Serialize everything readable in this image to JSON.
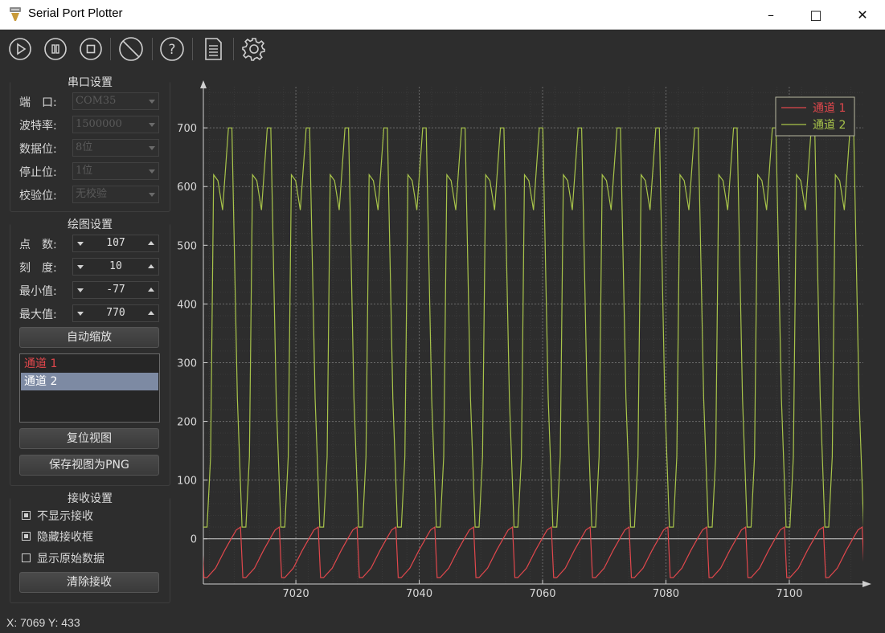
{
  "window": {
    "title": "Serial Port Plotter",
    "minimize": "–",
    "maximize": "□",
    "close": "✕"
  },
  "toolbar": [
    "play-icon",
    "pause-icon",
    "stop-icon",
    "clear-icon",
    "help-icon",
    "document-icon",
    "gear-icon"
  ],
  "serial": {
    "title": "串口设置",
    "port_label": "端　口:",
    "port_value": "COM35",
    "baud_label": "波特率:",
    "baud_value": "1500000",
    "databits_label": "数据位:",
    "databits_value": "8位",
    "stopbits_label": "停止位:",
    "stopbits_value": "1位",
    "parity_label": "校验位:",
    "parity_value": "无校验"
  },
  "plot_settings": {
    "title": "绘图设置",
    "points_label": "点　数:",
    "points_value": "107",
    "scale_label": "刻　度:",
    "scale_value": "10",
    "min_label": "最小值:",
    "min_value": "-77",
    "max_label": "最大值:",
    "max_value": "770",
    "autoscale_button": "自动缩放",
    "channels": [
      {
        "name": "通道 1",
        "color": "#e0474c"
      },
      {
        "name": "通道 2",
        "color": "#a8c44a"
      }
    ],
    "selected_channel": "通道 2",
    "reset_view_button": "复位视图",
    "save_png_button": "保存视图为PNG"
  },
  "receive": {
    "title": "接收设置",
    "hide_receive_label": "不显示接收",
    "hide_receive_checked": true,
    "hide_box_label": "隐藏接收框",
    "hide_box_checked": true,
    "raw_data_label": "显示原始数据",
    "raw_data_checked": false,
    "clear_button": "清除接收"
  },
  "status": {
    "text": "X: 7069 Y: 433"
  },
  "chart_data": {
    "type": "line",
    "x_range": [
      7005,
      7112
    ],
    "y_range": [
      -77,
      770
    ],
    "x_ticks": [
      7020,
      7040,
      7060,
      7080,
      7100
    ],
    "y_ticks": [
      0,
      100,
      200,
      300,
      400,
      500,
      600,
      700
    ],
    "grid": true,
    "legend_position": "top-right",
    "series": [
      {
        "name": "通道 1",
        "color": "#e0474c",
        "period": 6.3,
        "min": -68,
        "max": 20,
        "note_shape": "rising sawtooth with sharp drops"
      },
      {
        "name": "通道 2",
        "color": "#a8c44a",
        "period": 6.3,
        "min": 10,
        "max": 700,
        "secondary_peak": 620,
        "secondary_trough": 560
      }
    ]
  }
}
